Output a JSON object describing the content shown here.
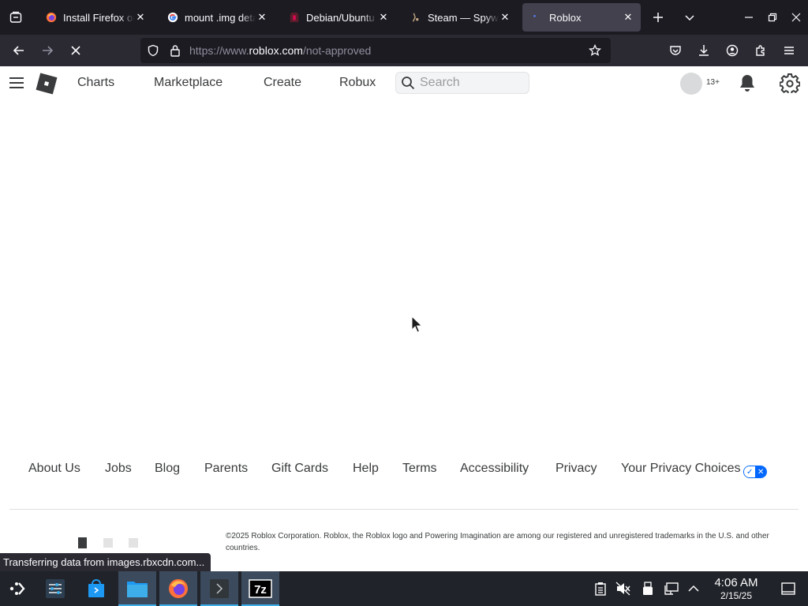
{
  "browser": {
    "tabs": [
      {
        "title": "Install Firefox on Linux",
        "favicon": "firefox-icon",
        "active": false
      },
      {
        "title": "mount .img details",
        "favicon": "google-icon",
        "active": false
      },
      {
        "title": "Debian/Ubuntu",
        "favicon": "debian-icon",
        "active": false
      },
      {
        "title": "Steam — Spyware",
        "favicon": "steam-icon",
        "active": false
      },
      {
        "title": "Roblox",
        "favicon": "roblox-icon",
        "active": true
      }
    ],
    "url": {
      "prefix": "https://www.",
      "domain": "roblox.com",
      "path": "/not-approved"
    },
    "status_text": "Transferring data from images.rbxcdn.com..."
  },
  "roblox": {
    "nav": {
      "charts": "Charts",
      "marketplace": "Marketplace",
      "create": "Create",
      "robux": "Robux"
    },
    "search_placeholder": "Search",
    "age_badge": "13+",
    "footer": {
      "links": [
        "About Us",
        "Jobs",
        "Blog",
        "Parents",
        "Gift Cards",
        "Help",
        "Terms",
        "Accessibility",
        "Privacy",
        "Your Privacy Choices"
      ],
      "copyright": "©2025 Roblox Corporation. Roblox, the Roblox logo and Powering Imagination are among our registered and unregistered trademarks in the U.S. and other countries."
    }
  },
  "taskbar": {
    "apps": [
      "app-launcher-icon",
      "system-settings-icon",
      "discover-store-icon",
      "file-manager-icon",
      "firefox-icon",
      "terminal-icon",
      "7zip-icon"
    ],
    "tray": [
      "clipboard-icon",
      "volume-muted-icon",
      "usb-device-icon",
      "network-icon",
      "tray-expand-icon"
    ],
    "clock": {
      "time": "4:06 AM",
      "date": "2/15/25"
    }
  },
  "colors": {
    "accent": "#0066ff",
    "tab_active": "#42414d",
    "toolbar": "#2b2a33",
    "tabstrip": "#1c1b22",
    "taskbar": "#20232a"
  }
}
